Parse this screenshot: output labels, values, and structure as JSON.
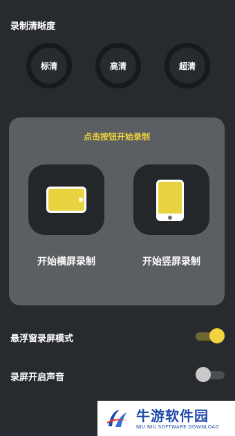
{
  "quality": {
    "title": "录制清晰度",
    "options": [
      "标清",
      "高清",
      "超清"
    ]
  },
  "panel": {
    "hint": "点击按钮开始录制",
    "landscape_label": "开始横屏录制",
    "portrait_label": "开始竖屏录制"
  },
  "settings": {
    "floating_mode": {
      "label": "悬浮窗录屏模式",
      "enabled": true
    },
    "record_audio": {
      "label": "录屏开启声音",
      "enabled": false
    }
  },
  "watermark": {
    "title": "牛游软件园",
    "subtitle": "NIU NIU SOFTWARE DOWNLOAD"
  },
  "colors": {
    "background": "#272a2e",
    "accent": "#efd43a",
    "panel": "#5b5e62",
    "brand": "#1f4aa8"
  }
}
